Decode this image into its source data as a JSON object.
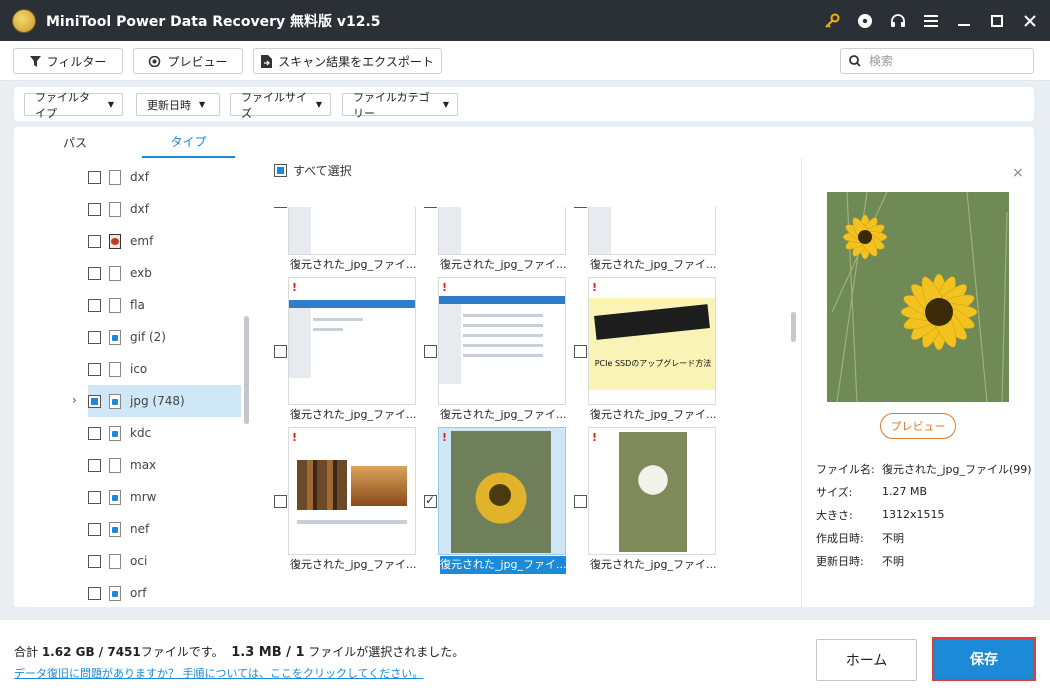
{
  "window": {
    "title": "MiniTool Power Data Recovery 無料版 v12.5",
    "icons": [
      "key-icon",
      "disc-icon",
      "headphones-icon",
      "menu-icon",
      "minimize-icon",
      "maximize-icon",
      "close-icon"
    ]
  },
  "toolbar": {
    "filter_label": "フィルター",
    "preview_label": "プレビュー",
    "export_label": "スキャン結果をエクスポート",
    "search_placeholder": "検索"
  },
  "filters": [
    {
      "label": "ファイルタイプ"
    },
    {
      "label": "更新日時"
    },
    {
      "label": "ファイルサイズ"
    },
    {
      "label": "ファイルカテゴリー"
    }
  ],
  "tabs": [
    {
      "label": "パス",
      "active": false
    },
    {
      "label": "タイプ",
      "active": true
    }
  ],
  "tree": {
    "items": [
      {
        "label": "dxf",
        "icon": "file-icon"
      },
      {
        "label": "dxf",
        "icon": "file-icon"
      },
      {
        "label": "emf",
        "icon": "emf-file-icon"
      },
      {
        "label": "exb",
        "icon": "file-icon"
      },
      {
        "label": "fla",
        "icon": "file-icon"
      },
      {
        "label": "gif (2)",
        "icon": "image-file-icon"
      },
      {
        "label": "ico",
        "icon": "file-icon"
      },
      {
        "label": "jpg (748)",
        "icon": "image-file-icon",
        "selected": true,
        "partial": true
      },
      {
        "label": "kdc",
        "icon": "image-file-icon"
      },
      {
        "label": "max",
        "icon": "file-icon"
      },
      {
        "label": "mrw",
        "icon": "image-file-icon"
      },
      {
        "label": "nef",
        "icon": "image-file-icon"
      },
      {
        "label": "oci",
        "icon": "file-icon"
      },
      {
        "label": "orf",
        "icon": "image-file-icon"
      }
    ]
  },
  "grid": {
    "select_all_label": "すべて選択",
    "files": [
      {
        "name": "復元された_jpg_ファイ...",
        "warn": false,
        "checked": false,
        "selected": false
      },
      {
        "name": "復元された_jpg_ファイ...",
        "warn": false,
        "checked": false,
        "selected": false
      },
      {
        "name": "復元された_jpg_ファイ...",
        "warn": false,
        "checked": false,
        "selected": false
      },
      {
        "name": "復元された_jpg_ファイ...",
        "warn": true,
        "checked": false,
        "selected": false
      },
      {
        "name": "復元された_jpg_ファイ...",
        "warn": true,
        "checked": false,
        "selected": false
      },
      {
        "name": "復元された_jpg_ファイ...",
        "warn": true,
        "checked": false,
        "selected": false
      },
      {
        "name": "復元された_jpg_ファイ...",
        "warn": true,
        "checked": false,
        "selected": false
      },
      {
        "name": "復元された_jpg_ファイ...",
        "warn": true,
        "checked": true,
        "selected": true
      },
      {
        "name": "復元された_jpg_ファイ...",
        "warn": true,
        "checked": false,
        "selected": false
      }
    ],
    "ssd_thumb_text": "PCIe SSDのアップグレード方法"
  },
  "preview": {
    "button_label": "プレビュー",
    "info": [
      {
        "label": "ファイル名:",
        "value": "復元された_jpg_ファイル(99)"
      },
      {
        "label": "サイズ:",
        "value": "1.27 MB"
      },
      {
        "label": "大きさ:",
        "value": "1312x1515"
      },
      {
        "label": "作成日時:",
        "value": "不明"
      },
      {
        "label": "更新日時:",
        "value": "不明"
      }
    ]
  },
  "status": {
    "total_prefix": "合計 ",
    "total_size": "1.62 GB",
    "total_sep": " / ",
    "total_files": "7451",
    "total_suffix": "ファイルです。",
    "selected_size": "1.3 MB",
    "selected_sep": " / ",
    "selected_count": "1",
    "selected_suffix": " ファイルが選択されました。",
    "help_link": "データ復旧に問題がありますか？ 手順については、ここをクリックしてください。"
  },
  "actions": {
    "home_label": "ホーム",
    "save_label": "保存"
  },
  "colors": {
    "accent": "#1c8ad6",
    "titlebar": "#2b3036",
    "warning": "#e02020",
    "save_border": "#e23b3b",
    "preview_button": "#e07a2c"
  }
}
